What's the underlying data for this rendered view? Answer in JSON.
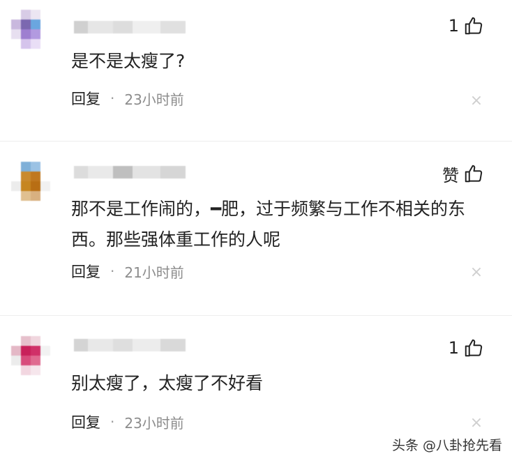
{
  "comments": [
    {
      "avatar_colors": [
        "#ffffff",
        "#d8cce6",
        "#ece6f2",
        "#ffffff",
        "#c9b8de",
        "#7b68b0",
        "#6aa6e0",
        "#ffffff",
        "#e7dff0",
        "#9e7fd0",
        "#b29ae0",
        "#ffffff",
        "#ffffff",
        "#d5c4ec",
        "#e9def6",
        "#ffffff"
      ],
      "name_blur_colors": [
        "#d0d0d0",
        "#e6e6e6",
        "#dddddd",
        "#efefef",
        "#e0e0e0"
      ],
      "like_label": "1",
      "text": "是不是太瘦了?",
      "reply_label": "回复",
      "separator": "·",
      "time": "23小时前",
      "close_symbol": "×"
    },
    {
      "avatar_colors": [
        "#ffffff",
        "#7fb0d8",
        "#9bc2e4",
        "#ffffff",
        "#ffffff",
        "#c98a2e",
        "#c07820",
        "#ffffff",
        "#ececec",
        "#c68620",
        "#b86e14",
        "#f1f1f1",
        "#ffffff",
        "#e0c090",
        "#d8b080",
        "#ffffff"
      ],
      "name_blur_colors": [
        "#dcdcdc",
        "#e9e9e9",
        "#bfbfbf",
        "#e3e3e3",
        "#d6d6d6"
      ],
      "like_label": "赞",
      "text": "那不是工作闹的，━肥，过于频繁与工作不相关的东西。那些强体重工作的人呢",
      "reply_label": "回复",
      "separator": "·",
      "time": "21小时前",
      "close_symbol": "×"
    },
    {
      "avatar_colors": [
        "#ffffff",
        "#e6c0cc",
        "#f0d6de",
        "#ffffff",
        "#e4b8c6",
        "#c8205a",
        "#d03068",
        "#f2f2f2",
        "#ececec",
        "#d84c7c",
        "#e06a90",
        "#ffffff",
        "#ffffff",
        "#f2d6e0",
        "#f6e6ec",
        "#ffffff"
      ],
      "name_blur_colors": [
        "#d4d4d4",
        "#e8e8e8",
        "#dedede",
        "#ececec",
        "#d9d9d9"
      ],
      "like_label": "1",
      "text": "别太瘦了，太瘦了不好看",
      "reply_label": "回复",
      "separator": "·",
      "time": "23小时前",
      "close_symbol": "×"
    }
  ],
  "watermark": "头条 @八卦抢先看"
}
